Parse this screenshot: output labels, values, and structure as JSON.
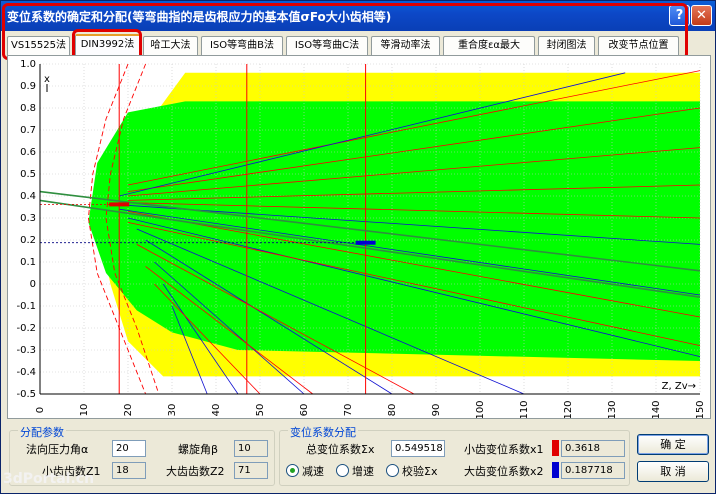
{
  "window": {
    "title": "变位系数的确定和分配(等弯曲指的是齿根应力的基本值σFo大小齿相等)",
    "help_label": "?",
    "close_label": "✕"
  },
  "tabs": [
    {
      "label": "VS15525法"
    },
    {
      "label": "DIN3992法"
    },
    {
      "label": "哈工大法"
    },
    {
      "label": "ISO等弯曲B法"
    },
    {
      "label": "ISO等弯曲C法"
    },
    {
      "label": "等滑动率法"
    },
    {
      "label": "重合度εα最大"
    },
    {
      "label": "封闭图法"
    },
    {
      "label": "改变节点位置"
    }
  ],
  "active_tab": "DIN3992法",
  "chart_data": {
    "type": "line",
    "ylabel": "x",
    "xlabel": "Z, Zv→",
    "xlim": [
      0,
      150
    ],
    "ylim": [
      -0.5,
      1.0
    ],
    "x_ticks": [
      "0",
      "10",
      "20",
      "30",
      "40",
      "50",
      "60",
      "70",
      "80",
      "90",
      "100",
      "110",
      "120",
      "130",
      "140",
      "150"
    ],
    "y_ticks": [
      "1.0",
      "0.9",
      "0.8",
      "0.7",
      "0.6",
      "0.5",
      "0.4",
      "0.3",
      "0.2",
      "0.1",
      "0",
      "-0.1",
      "-0.2",
      "-0.3",
      "-0.4",
      "-0.5"
    ],
    "grid": true,
    "background_colors": {
      "outer_region": "#ffff00",
      "inner_region": "#00ff00",
      "reference_lines": "#ff0000"
    },
    "series": [
      {
        "values": [
          [
            0,
            0.42
          ],
          [
            150,
            0.06
          ]
        ],
        "color": "#2f8f3f"
      },
      {
        "values": [
          [
            0,
            0.38
          ],
          [
            150,
            -0.06
          ]
        ],
        "color": "#2f8f3f"
      }
    ],
    "vertical_reference_x": [
      18,
      47,
      74
    ],
    "markers": [
      {
        "x": 18,
        "y": 0.3618,
        "color": "#e00000"
      },
      {
        "x": 74,
        "y": 0.187718,
        "color": "#0000d0"
      }
    ]
  },
  "distribution": {
    "title": "分配参数",
    "pressure_angle_label": "法向压力角α",
    "pressure_angle_value": "20",
    "helix_angle_label": "螺旋角β",
    "helix_angle_value": "10",
    "z1_label": "小齿齿数Z1",
    "z1_value": "18",
    "z2_label": "大齿齿数Z2",
    "z2_value": "71"
  },
  "shift": {
    "title": "变位系数分配",
    "total_label": "总变位系数Σx",
    "total_value": "0.549518",
    "x1_label": "小齿变位系数x1",
    "x1_value": "0.3618",
    "x2_label": "大齿变位系数x2",
    "x2_value": "0.187718",
    "x1_color": "#e00000",
    "x2_color": "#0000d0",
    "modes": [
      {
        "label": "减速",
        "selected": true
      },
      {
        "label": "增速",
        "selected": false
      },
      {
        "label": "校验Σx",
        "selected": false
      }
    ]
  },
  "buttons": {
    "ok": "确 定",
    "cancel": "取 消"
  },
  "watermark": "3dPortal.cn"
}
